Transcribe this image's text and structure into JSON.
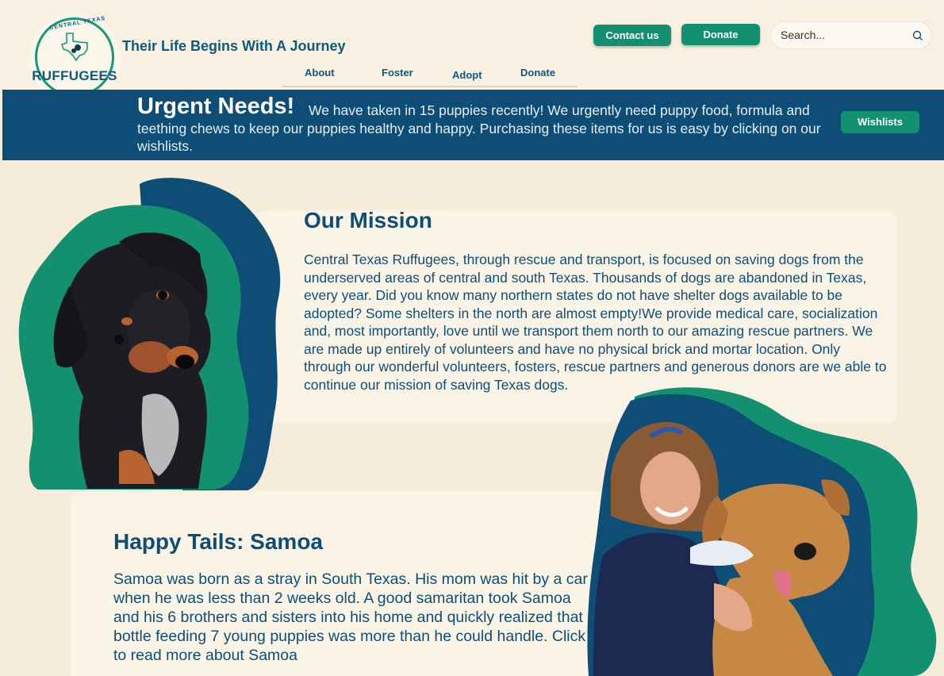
{
  "header": {
    "logo": {
      "arc_text": "CENTRAL TEXAS",
      "wordmark": "RUFFUGEES"
    },
    "tagline": "Their Life Begins With A Journey",
    "nav": [
      {
        "label": "About"
      },
      {
        "label": "Foster"
      },
      {
        "label": "Adopt"
      },
      {
        "label": "Donate"
      }
    ],
    "buttons": {
      "contact": "Contact us",
      "donate": "Donate"
    },
    "search": {
      "placeholder": "Search...",
      "icon": "search-icon"
    }
  },
  "urgent": {
    "title": "Urgent Needs!",
    "text": "We have taken in 15 puppies recently! We urgently need puppy food, formula and teething chews to keep our puppies healthy and happy. Purchasing these items for us is easy by clicking on our wishlists.",
    "button": "Wishlists"
  },
  "mission": {
    "title": "Our Mission",
    "text": "Central Texas Ruffugees, through rescue and transport, is focused on saving dogs from the underserved areas of central and south Texas. Thousands of dogs are abandoned in Texas, every year. Did you know many northern states do not have shelter dogs available to be adopted? Some shelters in the north are almost empty!We provide medical care, socialization and, most importantly, love until we transport them north to our amazing rescue partners. We are made up entirely of volunteers and have no physical brick and mortar location. Only through our wonderful volunteers, fosters, rescue partners and generous donors are we able to continue our mission of saving Texas dogs."
  },
  "happy_tails": {
    "title": "Happy Tails: Samoa",
    "text": "Samoa was born as a stray in South Texas. His mom was hit by a car when he was less than 2 weeks old. A good samaritan took Samoa and his 6 brothers and sisters into his home and quickly realized that bottle feeding 7 young puppies was more than he could handle. Click to read more about Samoa"
  },
  "colors": {
    "background": "#f5ecd9",
    "navy": "#0e4e76",
    "green": "#13906f",
    "card": "#faf4e6"
  }
}
